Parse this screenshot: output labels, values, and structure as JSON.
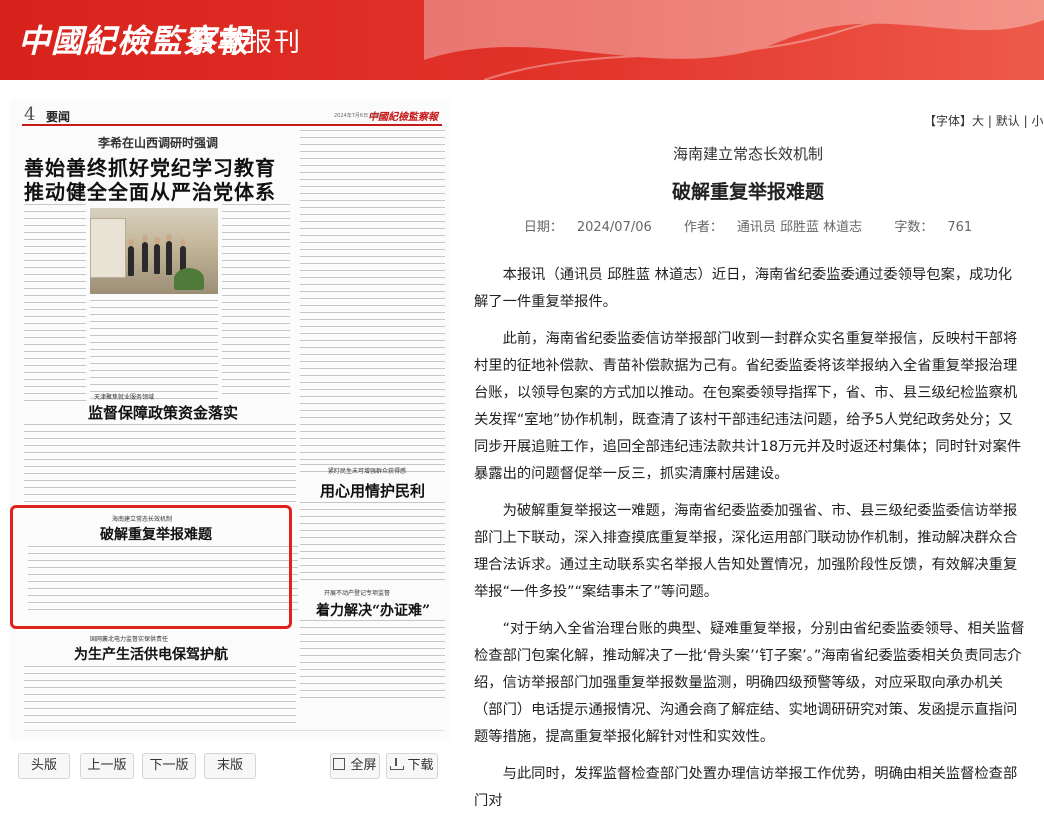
{
  "header": {
    "logo": "中國紀檢監察報",
    "subtitle": "数字报刊"
  },
  "paper": {
    "page_number": "4",
    "section": "要闻",
    "date": "2024年7月6日 星期六",
    "masthead_mini": "中國紀檢監察報",
    "story1": {
      "kicker": "李希在山西调研时强调",
      "headline_1": "善始善终抓好党纪学习教育",
      "headline_2": "推动健全全面从严治党体系"
    },
    "story2": {
      "kicker": "天津聚焦就业服务领域",
      "headline": "监督保障政策资金落实"
    },
    "story3": {
      "kicker": "海南建立常态长效机制",
      "headline": "破解重复举报难题"
    },
    "story4": {
      "kicker": "国网襄北电力监督实保供责任",
      "headline": "为生产生活供电保驾护航"
    },
    "story5": {
      "kicker": "紧盯民生未可增强群众获得感",
      "headline": "用心用情护民利"
    },
    "story6": {
      "kicker": "开展不动产登记专项监督",
      "headline": "着力解决“办证难”"
    }
  },
  "pager": {
    "first": "头版",
    "prev": "上一版",
    "next": "下一版",
    "last": "末版",
    "fullscreen": "全屏",
    "download": "下载"
  },
  "font_control": {
    "label": "【字体】",
    "large": "大",
    "default": "默认",
    "small": "小",
    "sep": "|"
  },
  "article": {
    "supertitle": "海南建立常态长效机制",
    "title": "破解重复举报难题",
    "date_label": "日期：",
    "date": "2024/07/06",
    "author_label": "作者：",
    "author": "通讯员 邱胜蓝 林道志",
    "words_label": "字数：",
    "words": "761",
    "paragraphs": [
      "本报讯（通讯员 邱胜蓝 林道志）近日，海南省纪委监委通过委领导包案，成功化解了一件重复举报件。",
      "此前，海南省纪委监委信访举报部门收到一封群众实名重复举报信，反映村干部将村里的征地补偿款、青苗补偿款据为己有。省纪委监委将该举报纳入全省重复举报治理台账，以领导包案的方式加以推动。在包案委领导指挥下，省、市、县三级纪检监察机关发挥“室地”协作机制，既查清了该村干部违纪违法问题，给予5人党纪政务处分；又同步开展追赃工作，追回全部违纪违法款共计18万元并及时返还村集体；同时针对案件暴露出的问题督促举一反三，抓实清廉村居建设。",
      "为破解重复举报这一难题，海南省纪委监委加强省、市、县三级纪委监委信访举报部门上下联动，深入排查摸底重复举报，深化运用部门联动协作机制，推动解决群众合理合法诉求。通过主动联系实名举报人告知处置情况，加强阶段性反馈，有效解决重复举报“一件多投”“案结事未了”等问题。",
      "“对于纳入全省治理台账的典型、疑难重复举报，分别由省纪委监委领导、相关监督检查部门包案化解，推动解决了一批‘骨头案’‘钉子案’。”海南省纪委监委相关负责同志介绍，信访举报部门加强重复举报数量监测，明确四级预警等级，对应采取向承办机关（部门）电话提示通报情况、沟通会商了解症结、实地调研研究对策、发函提示直指问题等措施，提高重复举报化解针对性和实效性。",
      "与此同时，发挥监督检查部门处置办理信访举报工作优势，明确由相关监督检查部门对"
    ]
  }
}
